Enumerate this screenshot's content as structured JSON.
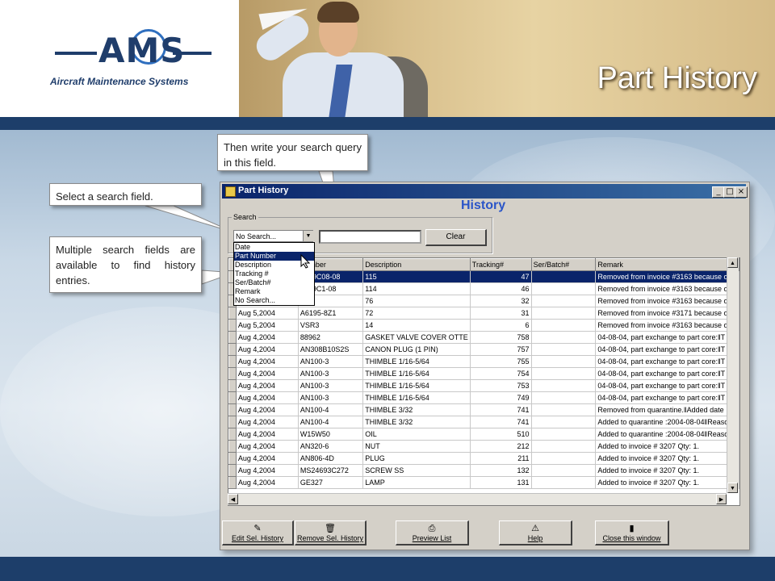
{
  "slide": {
    "title": "Part History",
    "logo_text": "AMS",
    "logo_subtitle": "Aircraft Maintenance Systems"
  },
  "callouts": {
    "query": "Then write your search query in this field.",
    "select": "Select a search field.",
    "multiple": "Multiple search fields are available to find history entries."
  },
  "window": {
    "title": "Part History",
    "heading": "History",
    "controls": {
      "minimize": "_",
      "maximize": "□",
      "close": "×"
    },
    "search": {
      "group_label": "Search",
      "combo_value": "No Search...",
      "query_value": "",
      "clear_label": "Clear",
      "options": [
        "Date",
        "Part Number",
        "Description",
        "Tracking #",
        "Ser/Batch#",
        "Remark",
        "No Search..."
      ],
      "selected_option": "Part Number"
    },
    "grid": {
      "columns": [
        "",
        "Number",
        "Description",
        "Tracking#",
        "Ser/Batch#",
        "Remark"
      ],
      "rows": [
        {
          "date": "",
          "part": "7039C08-08",
          "desc": "115",
          "tracking": "47",
          "ser": "",
          "remark": "Removed from invoice #3163 because o",
          "selected": true
        },
        {
          "date": "",
          "part": "7039C1-08",
          "desc": "114",
          "tracking": "46",
          "ser": "",
          "remark": "Removed from invoice #3163 because o"
        },
        {
          "date": "",
          "part": "4A",
          "desc": "76",
          "tracking": "32",
          "ser": "",
          "remark": "Removed from invoice #3163 because o"
        },
        {
          "date": "Aug 5,2004",
          "part": "A6195-8Z1",
          "desc": "72",
          "tracking": "31",
          "ser": "",
          "remark": "Removed from invoice #3171 because o"
        },
        {
          "date": "Aug 5,2004",
          "part": "VSR3",
          "desc": "14",
          "tracking": "6",
          "ser": "",
          "remark": "Removed from invoice #3163 because o"
        },
        {
          "date": "Aug 4,2004",
          "part": "88962",
          "desc": "GASKET VALVE COVER OTTE",
          "tracking": "758",
          "ser": "",
          "remark": "04-08-04,  part exchange to part core:‖T"
        },
        {
          "date": "Aug 4,2004",
          "part": "AN308B10S2S",
          "desc": "CANON PLUG (1 PIN)",
          "tracking": "757",
          "ser": "",
          "remark": "04-08-04,  part exchange to part core:‖T"
        },
        {
          "date": "Aug 4,2004",
          "part": "AN100-3",
          "desc": "THIMBLE 1/16-5/64",
          "tracking": "755",
          "ser": "",
          "remark": "04-08-04,  part exchange to part core:‖T"
        },
        {
          "date": "Aug 4,2004",
          "part": "AN100-3",
          "desc": "THIMBLE 1/16-5/64",
          "tracking": "754",
          "ser": "",
          "remark": "04-08-04,  part exchange to part core:‖T"
        },
        {
          "date": "Aug 4,2004",
          "part": "AN100-3",
          "desc": "THIMBLE 1/16-5/64",
          "tracking": "753",
          "ser": "",
          "remark": "04-08-04,  part exchange to part core:‖T"
        },
        {
          "date": "Aug 4,2004",
          "part": "AN100-3",
          "desc": "THIMBLE 1/16-5/64",
          "tracking": "749",
          "ser": "",
          "remark": "04-08-04,  part exchange to part core:‖T"
        },
        {
          "date": "Aug 4,2004",
          "part": "AN100-4",
          "desc": "THIMBLE 3/32",
          "tracking": "741",
          "ser": "",
          "remark": "Removed from quarantine.‖Added date :"
        },
        {
          "date": "Aug 4,2004",
          "part": "AN100-4",
          "desc": "THIMBLE 3/32",
          "tracking": "741",
          "ser": "",
          "remark": "Added to quarantine :2004-08-04‖Reaso"
        },
        {
          "date": "Aug 4,2004",
          "part": "W15W50",
          "desc": "OIL",
          "tracking": "510",
          "ser": "",
          "remark": "Added to quarantine :2004-08-04‖Reaso"
        },
        {
          "date": "Aug 4,2004",
          "part": "AN320-6",
          "desc": "NUT",
          "tracking": "212",
          "ser": "",
          "remark": "Added to invoice # 3207 Qty: 1."
        },
        {
          "date": "Aug 4,2004",
          "part": "AN806-4D",
          "desc": "PLUG",
          "tracking": "211",
          "ser": "",
          "remark": "Added to invoice # 3207 Qty: 1."
        },
        {
          "date": "Aug 4,2004",
          "part": "MS24693C272",
          "desc": "SCREW SS",
          "tracking": "132",
          "ser": "",
          "remark": "Added to invoice # 3207 Qty: 1."
        },
        {
          "date": "Aug 4,2004",
          "part": "GE327",
          "desc": "LAMP",
          "tracking": "131",
          "ser": "",
          "remark": "Added to invoice # 3207 Qty: 1."
        }
      ]
    },
    "buttons": [
      {
        "label": "Edit Sel. History",
        "icon": "pencil-icon"
      },
      {
        "label": "Remove Sel. History",
        "icon": "trash-icon"
      },
      {
        "label": "Preview List",
        "icon": "printer-icon"
      },
      {
        "label": "Help",
        "icon": "help-icon"
      },
      {
        "label": "Close this window",
        "icon": "door-icon"
      }
    ]
  },
  "colors": {
    "band": "#1d3e6a",
    "titlebar": "#0a246a",
    "history_heading": "#2a55c8"
  }
}
